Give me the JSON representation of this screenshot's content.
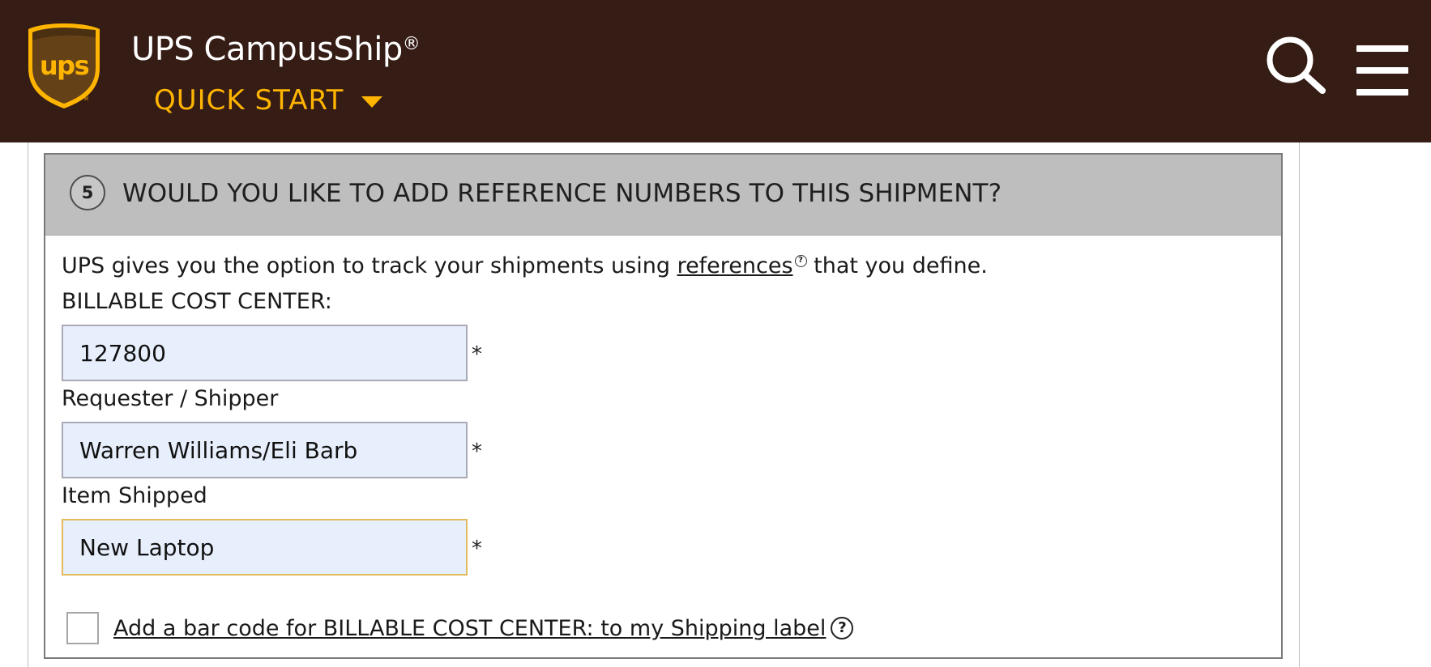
{
  "header": {
    "brand_name": "UPS CampusShip",
    "brand_mark": "®",
    "logo_text": "ups",
    "menu_label": "QUICK START",
    "icons": [
      "ups-shield-logo",
      "chevron-down-icon",
      "search-icon",
      "hamburger-menu-icon"
    ],
    "colors": {
      "bar": "#351c15",
      "accent": "#ffb500",
      "shield_fill": "#644117"
    }
  },
  "section": {
    "step_number": "5",
    "title": "WOULD YOU LIKE TO ADD REFERENCE NUMBERS TO THIS SHIPMENT?",
    "intro_prefix": "UPS gives you the option to track your shipments using ",
    "intro_link": "references",
    "intro_suffix": " that you define.",
    "fields": [
      {
        "label": "BILLABLE COST CENTER:",
        "value": "127800",
        "required_marker": "*"
      },
      {
        "label": "Requester / Shipper",
        "value": "Warren Williams/Eli Barb",
        "required_marker": "*"
      },
      {
        "label": "Item Shipped",
        "value": "New Laptop",
        "required_marker": "*"
      }
    ],
    "barcode_checkbox_label": "Add a bar code for BILLABLE COST CENTER: to my Shipping label",
    "barcode_checked": false,
    "help_glyph": "?",
    "colors": {
      "header_bg": "#bebebe",
      "input_bg": "#e8effc",
      "focus_border": "#e3bb5c"
    }
  }
}
